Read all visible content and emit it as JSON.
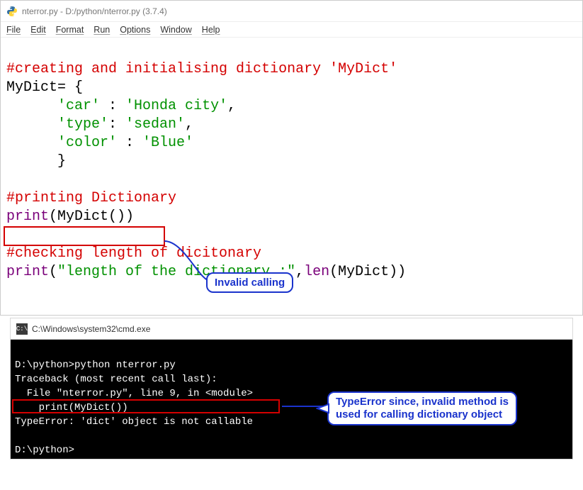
{
  "idle": {
    "title": "nterror.py - D:/python/nterror.py (3.7.4)",
    "menu": [
      "File",
      "Edit",
      "Format",
      "Run",
      "Options",
      "Window",
      "Help"
    ]
  },
  "code": {
    "l1_comment": "#creating and initialising dictionary 'MyDict'",
    "l2_a": "MyDict",
    "l2_b": "= {",
    "l3_a": "      ",
    "l3_s1": "'car'",
    "l3_m": " : ",
    "l3_s2": "'Honda city'",
    "l3_e": ",",
    "l4_a": "      ",
    "l4_s1": "'type'",
    "l4_m": ": ",
    "l4_s2": "'sedan'",
    "l4_e": ",",
    "l5_a": "      ",
    "l5_s1": "'color'",
    "l5_m": " : ",
    "l5_s2": "'Blue'",
    "l6": "      }",
    "l7": " ",
    "l8_comment": "#printing Dictionary",
    "l9_a": "print",
    "l9_b": "(MyDict())",
    "l10": " ",
    "l11_comment": "#checking length of dicitonary",
    "l12_a": "print",
    "l12_b": "(",
    "l12_s": "\"length of the dictionary :\"",
    "l12_c": ",",
    "l12_d": "len",
    "l12_e": "(MyDict))"
  },
  "callouts": {
    "c1": "Invalid calling",
    "c2a": "TypeError since, invalid method is",
    "c2b": "used for calling dictionary object"
  },
  "cmd": {
    "title": "C:\\Windows\\system32\\cmd.exe",
    "l1": "D:\\python>python nterror.py",
    "l2": "Traceback (most recent call last):",
    "l3": "  File \"nterror.py\", line 9, in <module>",
    "l4": "    print(MyDict())",
    "l5": "TypeError: 'dict' object is not callable",
    "l6": " ",
    "l7": "D:\\python>"
  }
}
